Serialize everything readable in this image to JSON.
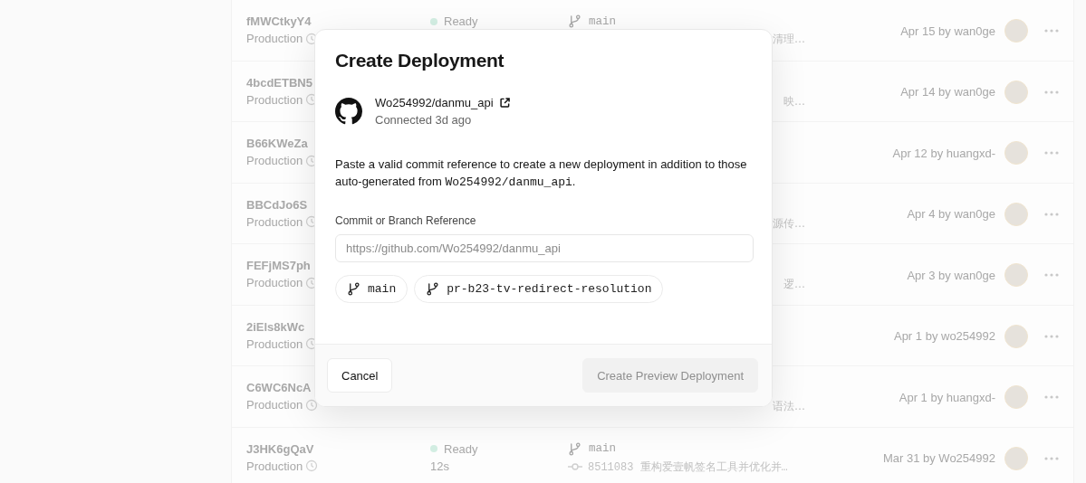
{
  "deployments": [
    {
      "id": "fMWCtkyY4",
      "environment": "Production",
      "status": "Ready",
      "branch": "main",
      "commit": "清理…",
      "date": "Apr 15 by wan0ge"
    },
    {
      "id": "4bcdETBN5",
      "environment": "Production",
      "commit": "映…",
      "date": "Apr 14 by wan0ge"
    },
    {
      "id": "B66KWeZa",
      "environment": "Production",
      "date": "Apr 12 by huangxd-"
    },
    {
      "id": "BBCdJo6S",
      "environment": "Production",
      "commit": "源传…",
      "date": "Apr 4 by wan0ge"
    },
    {
      "id": "FEFjMS7ph",
      "environment": "Production",
      "commit": "逻…",
      "date": "Apr 3 by wan0ge"
    },
    {
      "id": "2iEls8kWc",
      "environment": "Production",
      "date": "Apr 1 by wo254992"
    },
    {
      "id": "C6WC6NcA",
      "environment": "Production",
      "commit": "语法…",
      "date": "Apr 1 by huangxd-"
    },
    {
      "id": "J3HK6gQaV",
      "environment": "Production",
      "status": "Ready",
      "duration": "12s",
      "branch": "main",
      "commit": "8511083 重构爱壹帆签名工具并优化并…",
      "commit_icon": true,
      "date": "Mar 31 by Wo254992"
    }
  ],
  "dialog": {
    "title": "Create Deployment",
    "repository": "Wo254992/danmu_api",
    "connected": "Connected 3d ago",
    "description": "Paste a valid commit reference to create a new deployment in addition to those auto-generated from ",
    "description_code": "Wo254992/danmu_api",
    "description_end": ".",
    "field_label": "Commit or Branch Reference",
    "placeholder": "https://github.com/Wo254992/danmu_api",
    "branches": [
      "main",
      "pr-b23-tv-redirect-resolution"
    ],
    "cancel": "Cancel",
    "submit": {
      "label": "Create Preview Deployment",
      "disabled": true
    }
  }
}
